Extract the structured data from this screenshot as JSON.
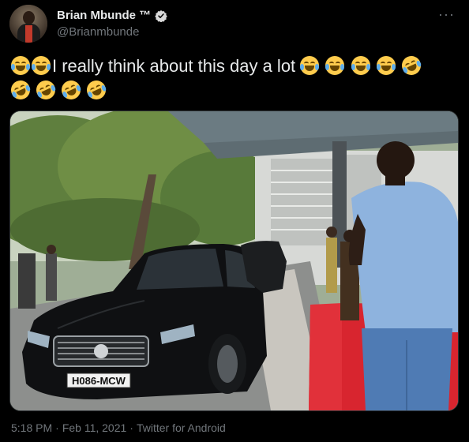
{
  "author": {
    "display_name": "Brian Mbunde ™",
    "handle": "@Brianmbunde",
    "verified": true
  },
  "tweet": {
    "text": "I really think about this day a lot",
    "emoji_before": [
      "face-with-tears-of-joy",
      "face-with-tears-of-joy"
    ],
    "emoji_after": [
      "face-with-tears-of-joy",
      "face-with-tears-of-joy",
      "face-with-tears-of-joy",
      "face-with-tears-of-joy",
      "rolling-on-the-floor-laughing",
      "rolling-on-the-floor-laughing",
      "rolling-on-the-floor-laughing",
      "rolling-on-the-floor-laughing",
      "rolling-on-the-floor-laughing"
    ]
  },
  "media": {
    "plate": "H086-MCW"
  },
  "meta": {
    "time": "5:18 PM",
    "separator": "·",
    "date": "Feb 11, 2021",
    "source": "Twitter for Android"
  },
  "colors": {
    "background": "#000000",
    "text": "#e7e9ea",
    "muted": "#71767b",
    "verified": "#d9d9d9"
  },
  "icons": {
    "more": "more-horizontal-icon",
    "verified": "verified-badge-icon"
  }
}
